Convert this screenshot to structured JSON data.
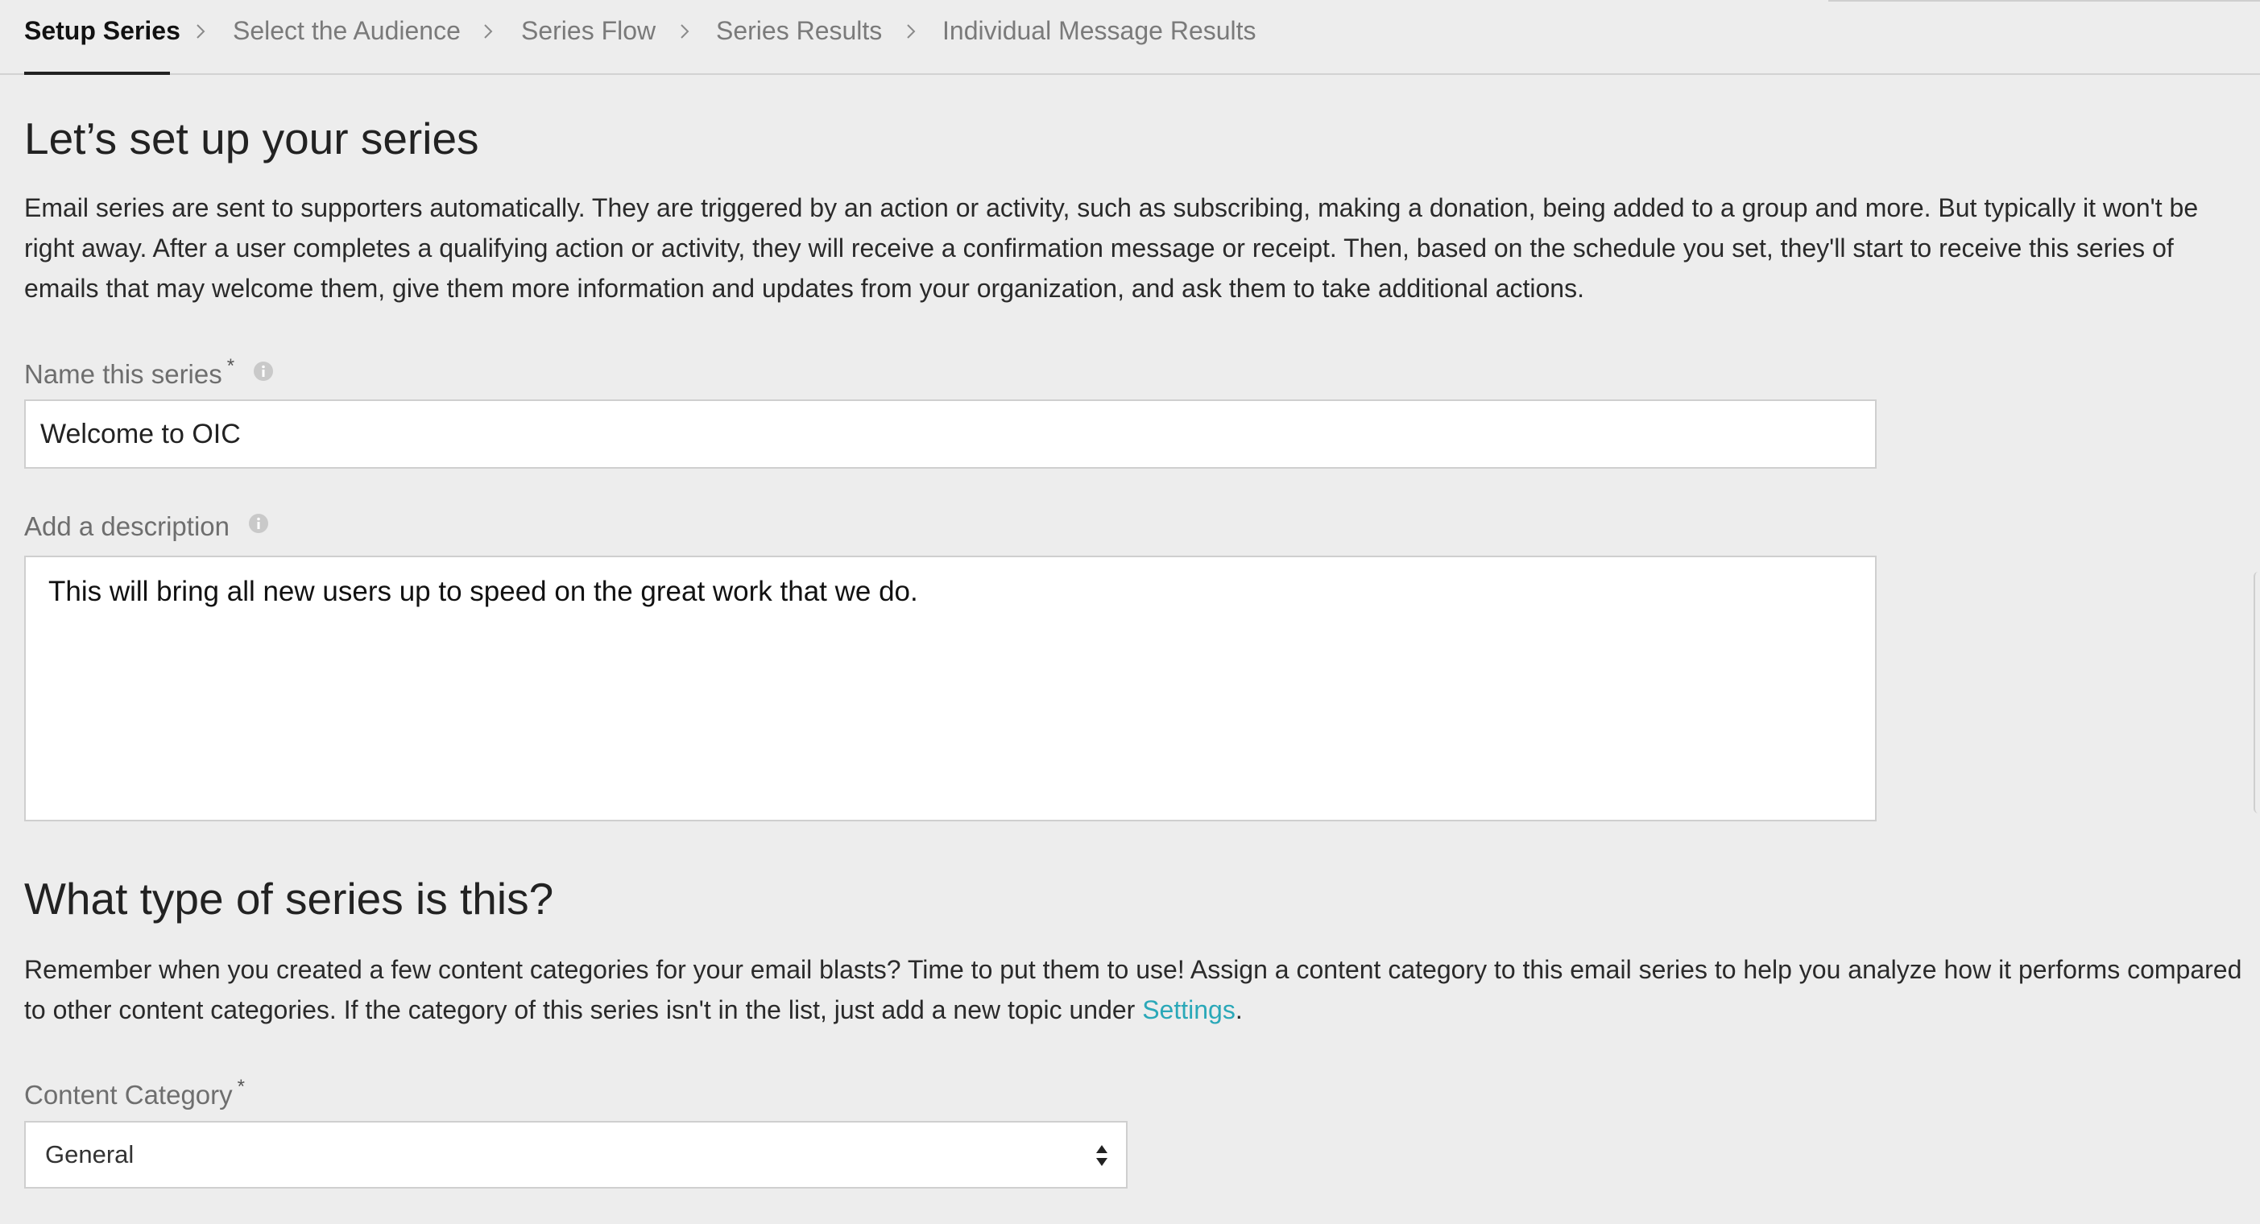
{
  "tabs": [
    {
      "label": "Setup Series",
      "active": true
    },
    {
      "label": "Select the Audience",
      "active": false
    },
    {
      "label": "Series Flow",
      "active": false
    },
    {
      "label": "Series Results",
      "active": false
    },
    {
      "label": "Individual Message Results",
      "active": false
    }
  ],
  "setup": {
    "title": "Let’s set up your series",
    "intro": "Email series are sent to supporters automatically. They are triggered by an action or activity, such as subscribing, making a donation, being added to a group and more. But typically it won't be right away. After a user completes a qualifying action or activity, they will receive a confirmation message or receipt. Then, based on the schedule you set, they'll start to receive this series of emails that may welcome them, give them more information and updates from your organization, and ask them to take additional actions.",
    "name_label": "Name this series",
    "name_required": "*",
    "name_value": "Welcome to OIC",
    "description_label": "Add a description",
    "description_value": "This will bring all new users up to speed on the great work that we do."
  },
  "type_section": {
    "title": "What type of series is this?",
    "intro_before_link": "Remember when you created a few content categories for your email blasts? Time to put them to use! Assign a content category to this email series to help you analyze how it performs compared to other content categories. If the category of this series isn't in the list, just add a new topic under ",
    "link_text": "Settings",
    "intro_after_link": ".",
    "category_label": "Content Category",
    "category_required": "*",
    "category_value": "General"
  },
  "icons": {
    "info": "info-circle-icon",
    "chevron": "chevron-right-icon",
    "select": "sort-arrows-icon"
  },
  "colors": {
    "link": "#2aa8b8",
    "background": "#ededed",
    "active_tab": "#111111",
    "inactive_tab": "#7a7a7a"
  }
}
